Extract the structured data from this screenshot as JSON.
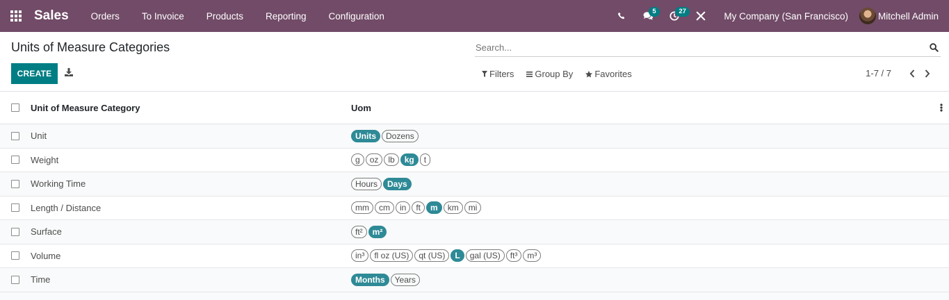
{
  "navbar": {
    "brand": "Sales",
    "menu": [
      "Orders",
      "To Invoice",
      "Products",
      "Reporting",
      "Configuration"
    ],
    "messages_badge": "5",
    "activities_badge": "27",
    "company": "My Company (San Francisco)",
    "user": "Mitchell Admin"
  },
  "control": {
    "title": "Units of Measure Categories",
    "create_label": "CREATE",
    "search_placeholder": "Search...",
    "filters_label": "Filters",
    "groupby_label": "Group By",
    "favorites_label": "Favorites",
    "pager": "1-7 / 7"
  },
  "table": {
    "headers": [
      "Unit of Measure Category",
      "Uom"
    ],
    "rows": [
      {
        "name": "Unit",
        "uoms": [
          {
            "label": "Units",
            "ref": true
          },
          {
            "label": "Dozens",
            "ref": false
          }
        ]
      },
      {
        "name": "Weight",
        "uoms": [
          {
            "label": "g",
            "ref": false
          },
          {
            "label": "oz",
            "ref": false
          },
          {
            "label": "lb",
            "ref": false
          },
          {
            "label": "kg",
            "ref": true
          },
          {
            "label": "t",
            "ref": false
          }
        ]
      },
      {
        "name": "Working Time",
        "uoms": [
          {
            "label": "Hours",
            "ref": false
          },
          {
            "label": "Days",
            "ref": true
          }
        ]
      },
      {
        "name": "Length / Distance",
        "uoms": [
          {
            "label": "mm",
            "ref": false
          },
          {
            "label": "cm",
            "ref": false
          },
          {
            "label": "in",
            "ref": false
          },
          {
            "label": "ft",
            "ref": false
          },
          {
            "label": "m",
            "ref": true
          },
          {
            "label": "km",
            "ref": false
          },
          {
            "label": "mi",
            "ref": false
          }
        ]
      },
      {
        "name": "Surface",
        "uoms": [
          {
            "label": "ft²",
            "ref": false
          },
          {
            "label": "m²",
            "ref": true
          }
        ]
      },
      {
        "name": "Volume",
        "uoms": [
          {
            "label": "in³",
            "ref": false
          },
          {
            "label": "fl oz (US)",
            "ref": false
          },
          {
            "label": "qt (US)",
            "ref": false
          },
          {
            "label": "L",
            "ref": true
          },
          {
            "label": "gal (US)",
            "ref": false
          },
          {
            "label": "ft³",
            "ref": false
          },
          {
            "label": "m³",
            "ref": false
          }
        ]
      },
      {
        "name": "Time",
        "uoms": [
          {
            "label": "Months",
            "ref": true
          },
          {
            "label": "Years",
            "ref": false
          }
        ]
      }
    ]
  },
  "colors": {
    "navbar": "#714b67",
    "primary": "#017e84",
    "tag_reference": "#2e8a96"
  }
}
